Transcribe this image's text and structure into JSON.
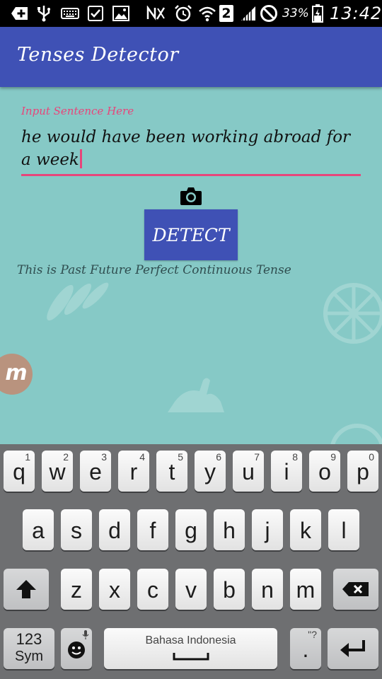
{
  "status_bar": {
    "icons": [
      "add-box-icon",
      "usb-icon",
      "keyboard-icon",
      "download-check-icon",
      "image-icon",
      "nfc-off-icon",
      "alarm-icon",
      "wifi-icon",
      "sim-2-icon",
      "signal-icon",
      "no-sync-icon",
      "battery-icon"
    ],
    "sim_slot": "2",
    "battery_percent": "33%",
    "time": "13:42"
  },
  "app_bar": {
    "title": "Tenses Detector",
    "color": "#3F51B5"
  },
  "form": {
    "input_label": "Input Sentence Here",
    "input_value": "he would have been working abroad for a week",
    "camera_icon": "camera-icon",
    "detect_label": "DETECT",
    "result_text": "This is Past Future Perfect Continuous Tense",
    "accent_color": "#E8457A",
    "background_color": "#86C9C6"
  },
  "overlay": {
    "badge_letter": "m"
  },
  "keyboard": {
    "row1": [
      {
        "key": "q",
        "hint": "1"
      },
      {
        "key": "w",
        "hint": "2"
      },
      {
        "key": "e",
        "hint": "3"
      },
      {
        "key": "r",
        "hint": "4"
      },
      {
        "key": "t",
        "hint": "5"
      },
      {
        "key": "y",
        "hint": "6"
      },
      {
        "key": "u",
        "hint": "7"
      },
      {
        "key": "i",
        "hint": "8"
      },
      {
        "key": "o",
        "hint": "9"
      },
      {
        "key": "p",
        "hint": "0"
      }
    ],
    "row2": [
      "a",
      "s",
      "d",
      "f",
      "g",
      "h",
      "j",
      "k",
      "l"
    ],
    "row3": [
      "z",
      "x",
      "c",
      "v",
      "b",
      "n",
      "m"
    ],
    "shift_icon": "shift-arrow-icon",
    "backspace_icon": "backspace-icon",
    "sym_top": "123",
    "sym_bottom": "Sym",
    "emoji_icon": "emoji-icon",
    "mic_icon": "mic-icon",
    "space_label": "Bahasa Indonesia",
    "period": ".",
    "period_hint": "\"?",
    "enter_icon": "enter-icon"
  }
}
